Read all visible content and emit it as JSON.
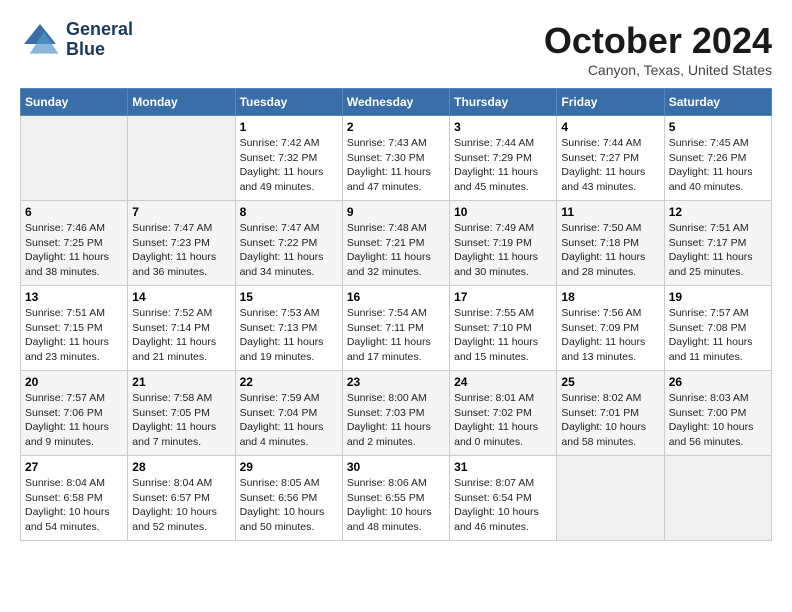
{
  "header": {
    "logo": {
      "line1": "General",
      "line2": "Blue"
    },
    "title": "October 2024",
    "location": "Canyon, Texas, United States"
  },
  "weekdays": [
    "Sunday",
    "Monday",
    "Tuesday",
    "Wednesday",
    "Thursday",
    "Friday",
    "Saturday"
  ],
  "weeks": [
    [
      {
        "day": "",
        "sunrise": "",
        "sunset": "",
        "daylight": ""
      },
      {
        "day": "",
        "sunrise": "",
        "sunset": "",
        "daylight": ""
      },
      {
        "day": "1",
        "sunrise": "Sunrise: 7:42 AM",
        "sunset": "Sunset: 7:32 PM",
        "daylight": "Daylight: 11 hours and 49 minutes."
      },
      {
        "day": "2",
        "sunrise": "Sunrise: 7:43 AM",
        "sunset": "Sunset: 7:30 PM",
        "daylight": "Daylight: 11 hours and 47 minutes."
      },
      {
        "day": "3",
        "sunrise": "Sunrise: 7:44 AM",
        "sunset": "Sunset: 7:29 PM",
        "daylight": "Daylight: 11 hours and 45 minutes."
      },
      {
        "day": "4",
        "sunrise": "Sunrise: 7:44 AM",
        "sunset": "Sunset: 7:27 PM",
        "daylight": "Daylight: 11 hours and 43 minutes."
      },
      {
        "day": "5",
        "sunrise": "Sunrise: 7:45 AM",
        "sunset": "Sunset: 7:26 PM",
        "daylight": "Daylight: 11 hours and 40 minutes."
      }
    ],
    [
      {
        "day": "6",
        "sunrise": "Sunrise: 7:46 AM",
        "sunset": "Sunset: 7:25 PM",
        "daylight": "Daylight: 11 hours and 38 minutes."
      },
      {
        "day": "7",
        "sunrise": "Sunrise: 7:47 AM",
        "sunset": "Sunset: 7:23 PM",
        "daylight": "Daylight: 11 hours and 36 minutes."
      },
      {
        "day": "8",
        "sunrise": "Sunrise: 7:47 AM",
        "sunset": "Sunset: 7:22 PM",
        "daylight": "Daylight: 11 hours and 34 minutes."
      },
      {
        "day": "9",
        "sunrise": "Sunrise: 7:48 AM",
        "sunset": "Sunset: 7:21 PM",
        "daylight": "Daylight: 11 hours and 32 minutes."
      },
      {
        "day": "10",
        "sunrise": "Sunrise: 7:49 AM",
        "sunset": "Sunset: 7:19 PM",
        "daylight": "Daylight: 11 hours and 30 minutes."
      },
      {
        "day": "11",
        "sunrise": "Sunrise: 7:50 AM",
        "sunset": "Sunset: 7:18 PM",
        "daylight": "Daylight: 11 hours and 28 minutes."
      },
      {
        "day": "12",
        "sunrise": "Sunrise: 7:51 AM",
        "sunset": "Sunset: 7:17 PM",
        "daylight": "Daylight: 11 hours and 25 minutes."
      }
    ],
    [
      {
        "day": "13",
        "sunrise": "Sunrise: 7:51 AM",
        "sunset": "Sunset: 7:15 PM",
        "daylight": "Daylight: 11 hours and 23 minutes."
      },
      {
        "day": "14",
        "sunrise": "Sunrise: 7:52 AM",
        "sunset": "Sunset: 7:14 PM",
        "daylight": "Daylight: 11 hours and 21 minutes."
      },
      {
        "day": "15",
        "sunrise": "Sunrise: 7:53 AM",
        "sunset": "Sunset: 7:13 PM",
        "daylight": "Daylight: 11 hours and 19 minutes."
      },
      {
        "day": "16",
        "sunrise": "Sunrise: 7:54 AM",
        "sunset": "Sunset: 7:11 PM",
        "daylight": "Daylight: 11 hours and 17 minutes."
      },
      {
        "day": "17",
        "sunrise": "Sunrise: 7:55 AM",
        "sunset": "Sunset: 7:10 PM",
        "daylight": "Daylight: 11 hours and 15 minutes."
      },
      {
        "day": "18",
        "sunrise": "Sunrise: 7:56 AM",
        "sunset": "Sunset: 7:09 PM",
        "daylight": "Daylight: 11 hours and 13 minutes."
      },
      {
        "day": "19",
        "sunrise": "Sunrise: 7:57 AM",
        "sunset": "Sunset: 7:08 PM",
        "daylight": "Daylight: 11 hours and 11 minutes."
      }
    ],
    [
      {
        "day": "20",
        "sunrise": "Sunrise: 7:57 AM",
        "sunset": "Sunset: 7:06 PM",
        "daylight": "Daylight: 11 hours and 9 minutes."
      },
      {
        "day": "21",
        "sunrise": "Sunrise: 7:58 AM",
        "sunset": "Sunset: 7:05 PM",
        "daylight": "Daylight: 11 hours and 7 minutes."
      },
      {
        "day": "22",
        "sunrise": "Sunrise: 7:59 AM",
        "sunset": "Sunset: 7:04 PM",
        "daylight": "Daylight: 11 hours and 4 minutes."
      },
      {
        "day": "23",
        "sunrise": "Sunrise: 8:00 AM",
        "sunset": "Sunset: 7:03 PM",
        "daylight": "Daylight: 11 hours and 2 minutes."
      },
      {
        "day": "24",
        "sunrise": "Sunrise: 8:01 AM",
        "sunset": "Sunset: 7:02 PM",
        "daylight": "Daylight: 11 hours and 0 minutes."
      },
      {
        "day": "25",
        "sunrise": "Sunrise: 8:02 AM",
        "sunset": "Sunset: 7:01 PM",
        "daylight": "Daylight: 10 hours and 58 minutes."
      },
      {
        "day": "26",
        "sunrise": "Sunrise: 8:03 AM",
        "sunset": "Sunset: 7:00 PM",
        "daylight": "Daylight: 10 hours and 56 minutes."
      }
    ],
    [
      {
        "day": "27",
        "sunrise": "Sunrise: 8:04 AM",
        "sunset": "Sunset: 6:58 PM",
        "daylight": "Daylight: 10 hours and 54 minutes."
      },
      {
        "day": "28",
        "sunrise": "Sunrise: 8:04 AM",
        "sunset": "Sunset: 6:57 PM",
        "daylight": "Daylight: 10 hours and 52 minutes."
      },
      {
        "day": "29",
        "sunrise": "Sunrise: 8:05 AM",
        "sunset": "Sunset: 6:56 PM",
        "daylight": "Daylight: 10 hours and 50 minutes."
      },
      {
        "day": "30",
        "sunrise": "Sunrise: 8:06 AM",
        "sunset": "Sunset: 6:55 PM",
        "daylight": "Daylight: 10 hours and 48 minutes."
      },
      {
        "day": "31",
        "sunrise": "Sunrise: 8:07 AM",
        "sunset": "Sunset: 6:54 PM",
        "daylight": "Daylight: 10 hours and 46 minutes."
      },
      {
        "day": "",
        "sunrise": "",
        "sunset": "",
        "daylight": ""
      },
      {
        "day": "",
        "sunrise": "",
        "sunset": "",
        "daylight": ""
      }
    ]
  ]
}
